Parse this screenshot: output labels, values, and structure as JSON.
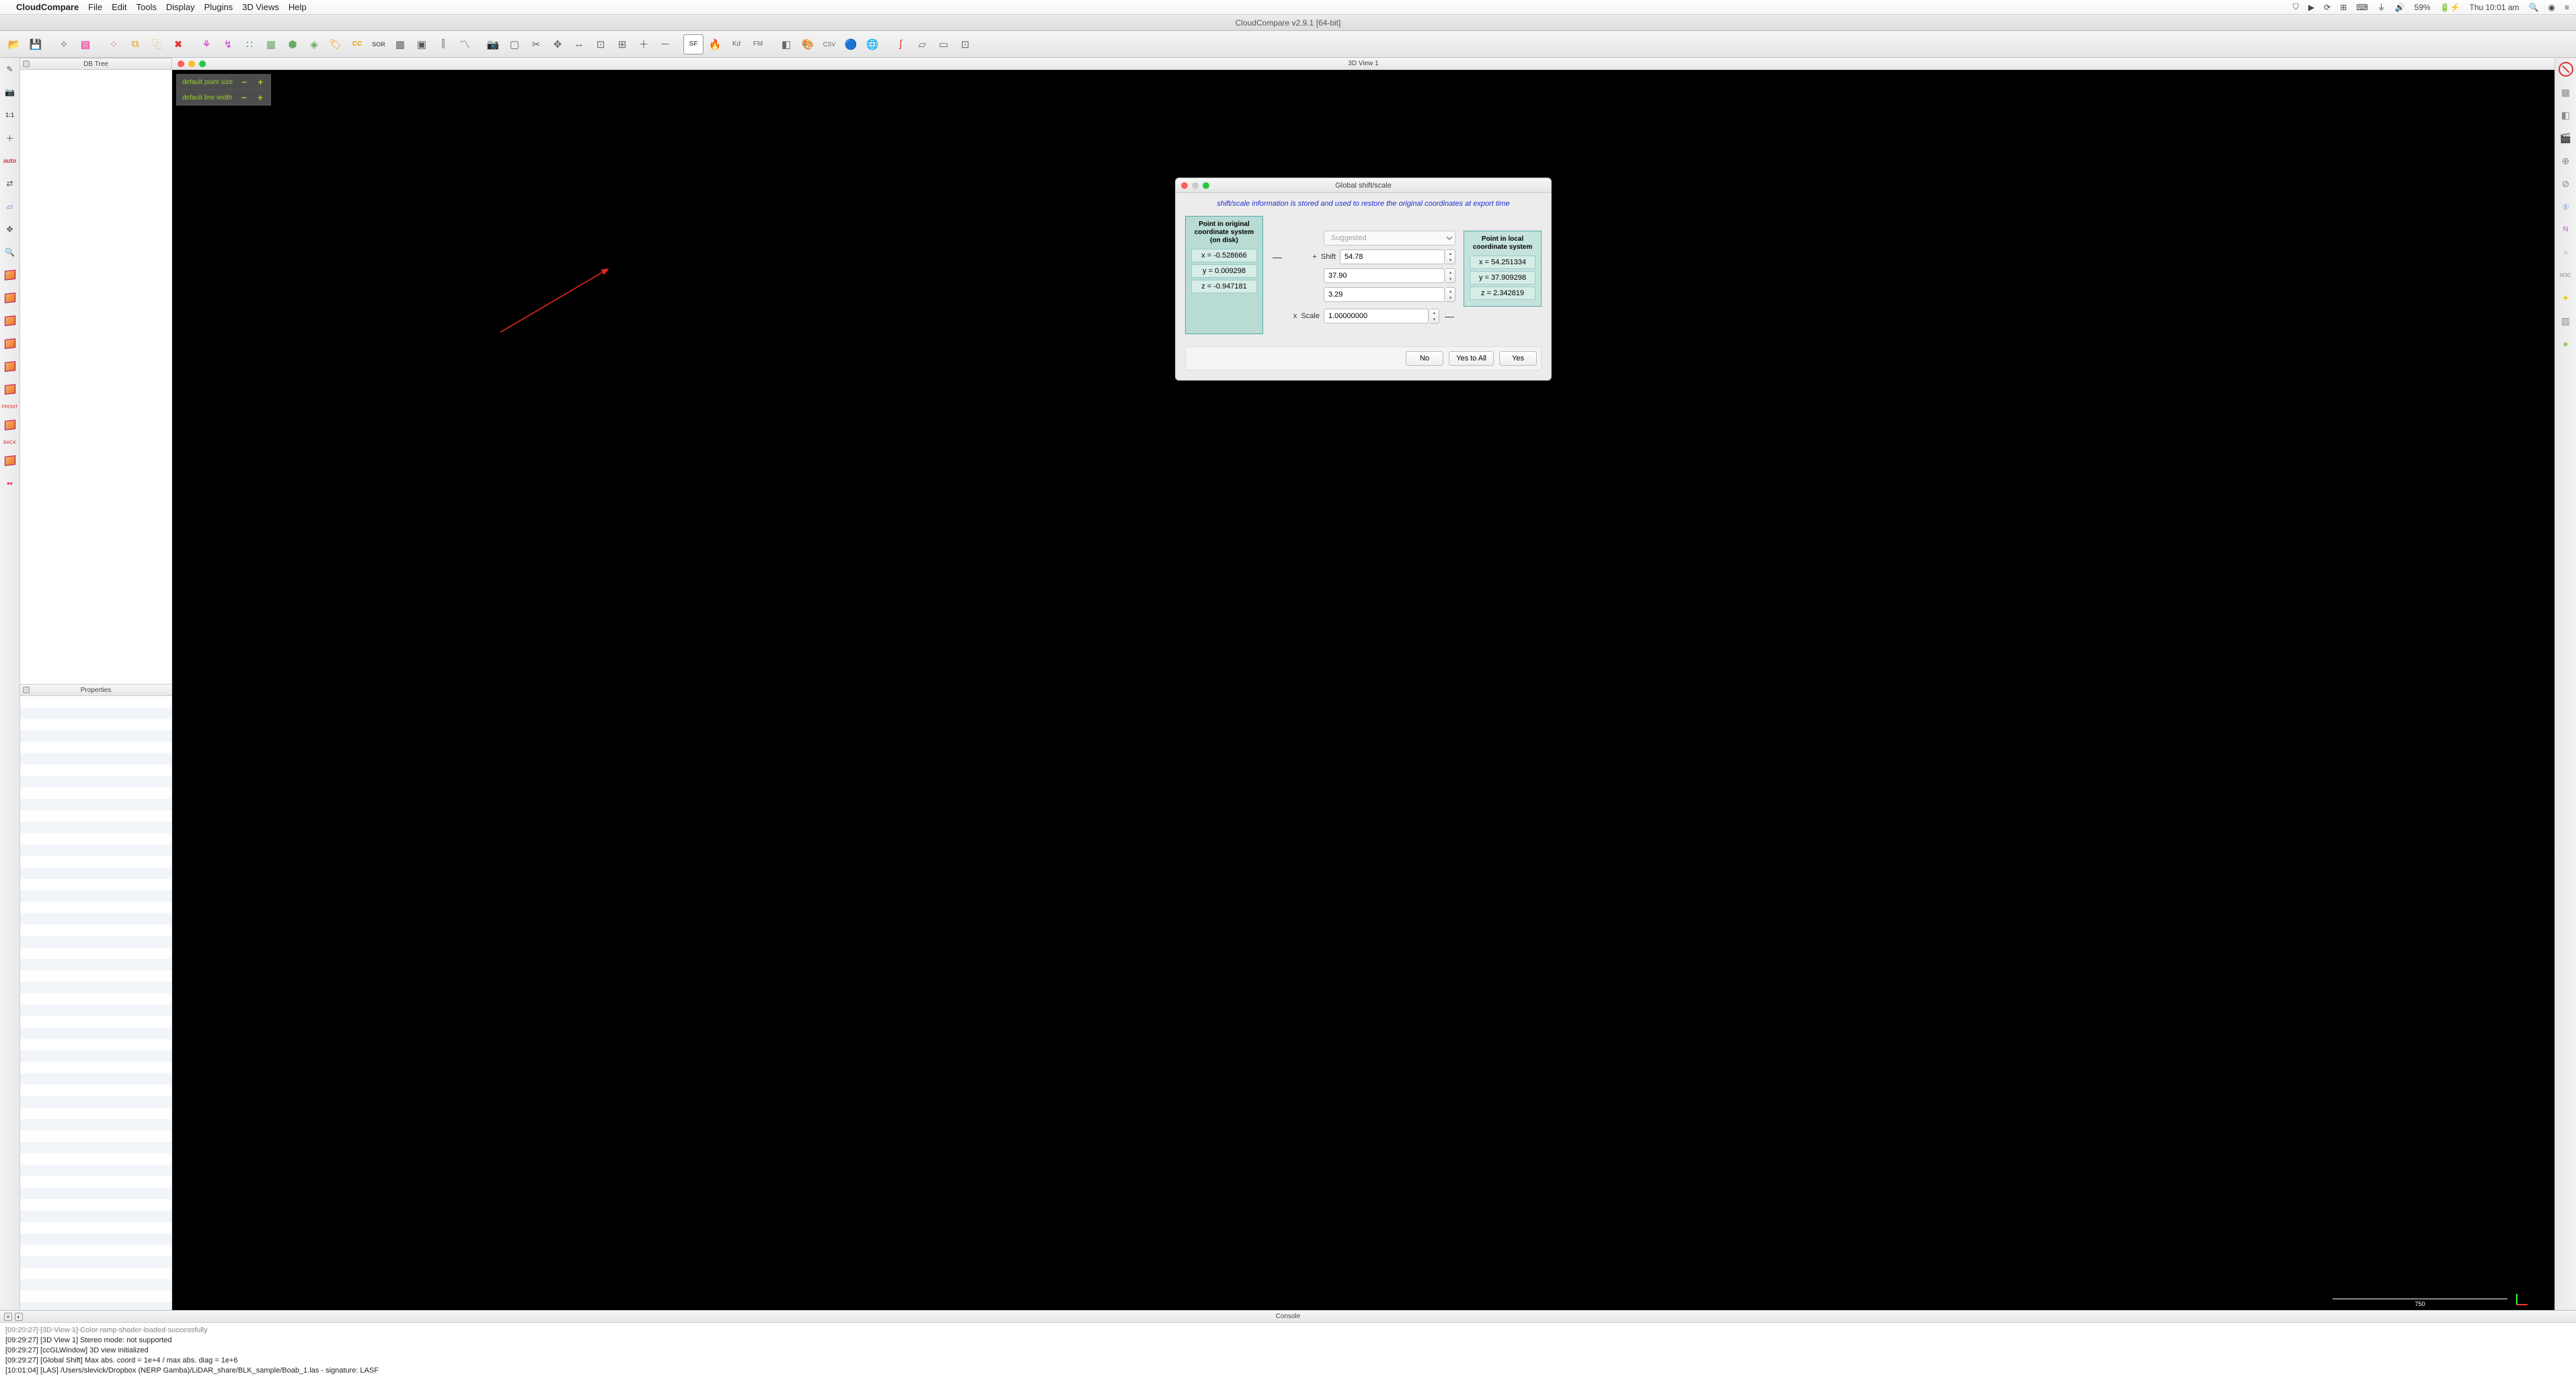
{
  "menubar": {
    "app": "CloudCompare",
    "items": [
      "File",
      "Edit",
      "Tools",
      "Display",
      "Plugins",
      "3D Views",
      "Help"
    ],
    "battery": "59%",
    "clock": "Thu 10:01 am"
  },
  "window_title": "CloudCompare v2.9.1 [64-bit]",
  "panels": {
    "dbtree": "DB Tree",
    "properties": "Properties",
    "view3d": "3D View 1",
    "console": "Console"
  },
  "hud": {
    "row1_label": "default point size",
    "row2_label": "default line width"
  },
  "scale_value": "750",
  "left_tool_labels": {
    "oneone": "1:1",
    "auto": "auto",
    "front": "FRONT",
    "back": "BACK"
  },
  "toolbar_text_icons": {
    "sor": "SOR",
    "cc": "CC",
    "sf": "SF",
    "kd": "Kd",
    "fm": "FM",
    "csv": "CSV",
    "n": "N",
    "m3c": "M3C"
  },
  "dialog": {
    "title": "Global shift/scale",
    "info": "shift/scale information is stored and used to restore the original coordinates at export time",
    "orig_title": "Point in original coordinate system (on disk)",
    "local_title": "Point in local coordinate system",
    "orig": {
      "x": "x = -0.528666",
      "y": "y = 0.009298",
      "z": "z = -0.947181"
    },
    "local": {
      "x": "x = 54.251334",
      "y": "y = 37.909298",
      "z": "z = 2.342819"
    },
    "mode": "Suggested",
    "shift_label": "Shift",
    "scale_label": "Scale",
    "shift": {
      "x": "54.78",
      "y": "37.90",
      "z": "3.29"
    },
    "scale": "1.00000000",
    "plus": "+",
    "times": "x",
    "btn_no": "No",
    "btn_yesall": "Yes to All",
    "btn_yes": "Yes"
  },
  "console_lines": [
    "[09:29:27] [3D View 1] Color ramp shader loaded successfully",
    "[09:29:27] [3D View 1] Stereo mode: not supported",
    "[09:29:27] [ccGLWindow] 3D view initialized",
    "[09:29:27] [Global Shift] Max abs. coord = 1e+4 / max abs. diag = 1e+6",
    "[10:01:04] [LAS] /Users/slevick/Dropbox (NERP Gamba)/LiDAR_share/BLK_sample/Boab_1.las - signature: LASF"
  ]
}
